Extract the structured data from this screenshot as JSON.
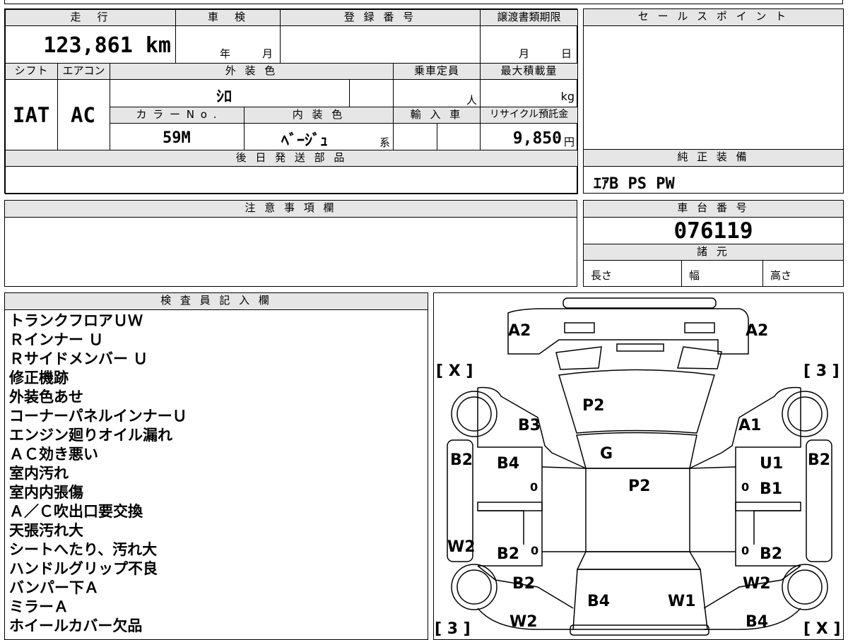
{
  "main_info": {
    "mileage_label": "走　行",
    "mileage_value": "123,861 km",
    "shaken_label": "車　検",
    "shaken_year": "年",
    "shaken_month": "月",
    "reg_label": "登 録 番 号",
    "transfer_label": "譲渡書類期限",
    "transfer_month": "月",
    "transfer_day": "日",
    "shift_label": "シフト",
    "shift_value": "IAT",
    "ac_label": "エアコン",
    "ac_value": "AC",
    "ext_color_label": "外 装 色",
    "ext_color_value": "ｼﾛ",
    "capacity_label": "乗車定員",
    "capacity_unit": "人",
    "load_label": "最大積載量",
    "load_unit": "kg",
    "color_no_label": "カ ラ ー N o .",
    "color_no_value": "59M",
    "int_color_label": "内 装 色",
    "int_color_value": "ﾍﾞｰｼﾞｭ",
    "int_color_suffix": "系",
    "import_label": "輸 入 車",
    "recycle_label": "リサイクル預託金",
    "recycle_value": "9,850",
    "recycle_unit": "円",
    "parts_label": "後 日 発 送 部 品"
  },
  "sales_point": {
    "label": "セ ー ル ス ポ イ ン ト"
  },
  "equipment": {
    "label": "純 正 装 備",
    "value": "ｴｱB PS PW"
  },
  "caution": {
    "label": "注 意 事 項 欄"
  },
  "chassis": {
    "label": "車 台 番 号",
    "value": "076119"
  },
  "specs": {
    "label": "諸 元",
    "length": "長さ",
    "width": "幅",
    "height": "高さ"
  },
  "inspector": {
    "label": "検 査 員 記 入 欄",
    "notes": [
      "トランクフロアＵＷ",
      "Ｒインナー Ｕ",
      "Ｒサイドメンバー Ｕ",
      "修正機跡",
      "外装色あせ",
      "コーナーパネルインナーＵ",
      "エンジン廻りオイル漏れ",
      "ＡＣ効き悪い",
      "室内汚れ",
      "室内内張傷",
      "Ａ／Ｃ吹出口要交換",
      "天張汚れ大",
      "シートへたり、汚れ大",
      "ハンドルグリップ不良",
      "バンパー下Ａ",
      "ミラーＡ",
      "ホイールカバー欠品"
    ]
  },
  "diagram": {
    "labels": {
      "a2_left": "A2",
      "a2_right": "A2",
      "x_top": "[ X ]",
      "three_top": "[ 3 ]",
      "p2_top": "P2",
      "b3": "B3",
      "a1": "A1",
      "g": "G",
      "b2_left_side": "B2",
      "b2_right_side": "B2",
      "b4_left": "B4",
      "u1": "U1",
      "p2_center": "P2",
      "zero_1": "0",
      "zero_2": "0",
      "b1": "B1",
      "w2_left_side": "W2",
      "b2_left_lower": "B2",
      "zero_3": "0",
      "zero_4": "0",
      "b2_right_lower": "B2",
      "b2_left_bottom": "B2",
      "w2_right": "W2",
      "b4_bottom": "B4",
      "w1": "W1",
      "three_bottom": "[ 3 ]",
      "w2_left_bottom": "W2",
      "b4_right_bottom": "B4",
      "x_bottom": "[ X ]"
    }
  }
}
